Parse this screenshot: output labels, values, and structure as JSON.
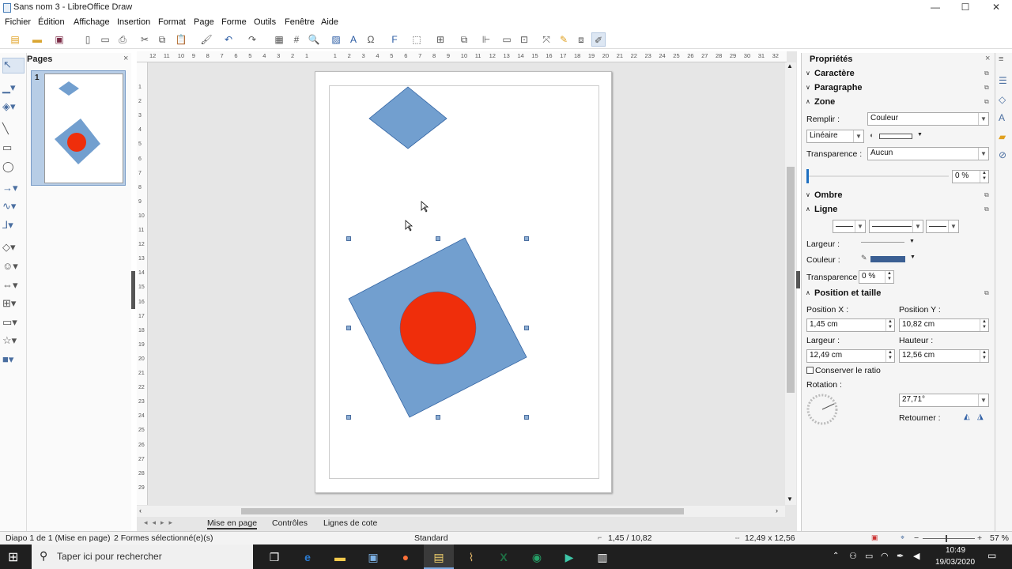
{
  "window": {
    "title": "Sans nom 3 - LibreOffice Draw",
    "minimize": "—",
    "maximize": "☐",
    "close": "✕"
  },
  "menu": [
    "Fichier",
    "Édition",
    "Affichage",
    "Insertion",
    "Format",
    "Page",
    "Forme",
    "Outils",
    "Fenêtre",
    "Aide"
  ],
  "pages_panel": {
    "title": "Pages",
    "close": "×",
    "thumb_number": "1"
  },
  "ruler": {
    "h_ticks": [
      "12",
      "11",
      "10",
      "9",
      "8",
      "7",
      "6",
      "5",
      "4",
      "3",
      "2",
      "1",
      "",
      "1",
      "2",
      "3",
      "4",
      "5",
      "6",
      "7",
      "8",
      "9",
      "10",
      "11",
      "12",
      "13",
      "14",
      "15",
      "16",
      "17",
      "18",
      "19",
      "20",
      "21",
      "22",
      "23",
      "24",
      "25",
      "26",
      "27",
      "28",
      "29",
      "30",
      "31",
      "32"
    ],
    "v_ticks": [
      "1",
      "2",
      "3",
      "4",
      "5",
      "6",
      "7",
      "8",
      "9",
      "10",
      "11",
      "12",
      "13",
      "14",
      "15",
      "16",
      "17",
      "18",
      "19",
      "20",
      "21",
      "22",
      "23",
      "24",
      "25",
      "26",
      "27",
      "28",
      "29"
    ]
  },
  "tabs": {
    "layout": "Mise en page",
    "controls": "Contrôles",
    "dimension_lines": "Lignes de cote"
  },
  "sidebar": {
    "title": "Propriétés",
    "close": "×",
    "sections": {
      "character": "Caractère",
      "paragraph": "Paragraphe",
      "zone": "Zone",
      "shadow": "Ombre",
      "line": "Ligne",
      "position_size": "Position et taille"
    },
    "zone": {
      "fill_label": "Remplir :",
      "fill_value": "Couleur",
      "gradient_value": "Linéaire",
      "transparency_label": "Transparence :",
      "transparency_value": "Aucun",
      "transparency_percent": "0 %"
    },
    "line": {
      "width_label": "Largeur :",
      "color_label": "Couleur :",
      "transparency_label": "Transparence :",
      "transparency_value": "0 %",
      "color": "#3b5f93"
    },
    "position": {
      "pos_x_label": "Position X :",
      "pos_x": "1,45 cm",
      "pos_y_label": "Position Y :",
      "pos_y": "10,82 cm",
      "width_label": "Largeur :",
      "width": "12,49 cm",
      "height_label": "Hauteur :",
      "height": "12,56 cm",
      "keep_ratio": "Conserver le ratio",
      "rotation_label": "Rotation :",
      "rotation": "27,71°",
      "flip_label": "Retourner :"
    }
  },
  "status": {
    "slide": "Diapo 1 de 1 (Mise en page)",
    "selection": "2 Formes sélectionné(e)(s)",
    "style": "Standard",
    "position": "1,45 / 10,82",
    "size": "12,49 x 12,56",
    "zoom": "57 %"
  },
  "taskbar": {
    "search_placeholder": "Taper ici pour rechercher",
    "time": "10:49",
    "date": "19/03/2020"
  },
  "colors": {
    "shape_blue": "#729fcf",
    "shape_red": "#ef2e0b",
    "shape_border": "#3465a4",
    "accent": "#1e6fc1"
  }
}
